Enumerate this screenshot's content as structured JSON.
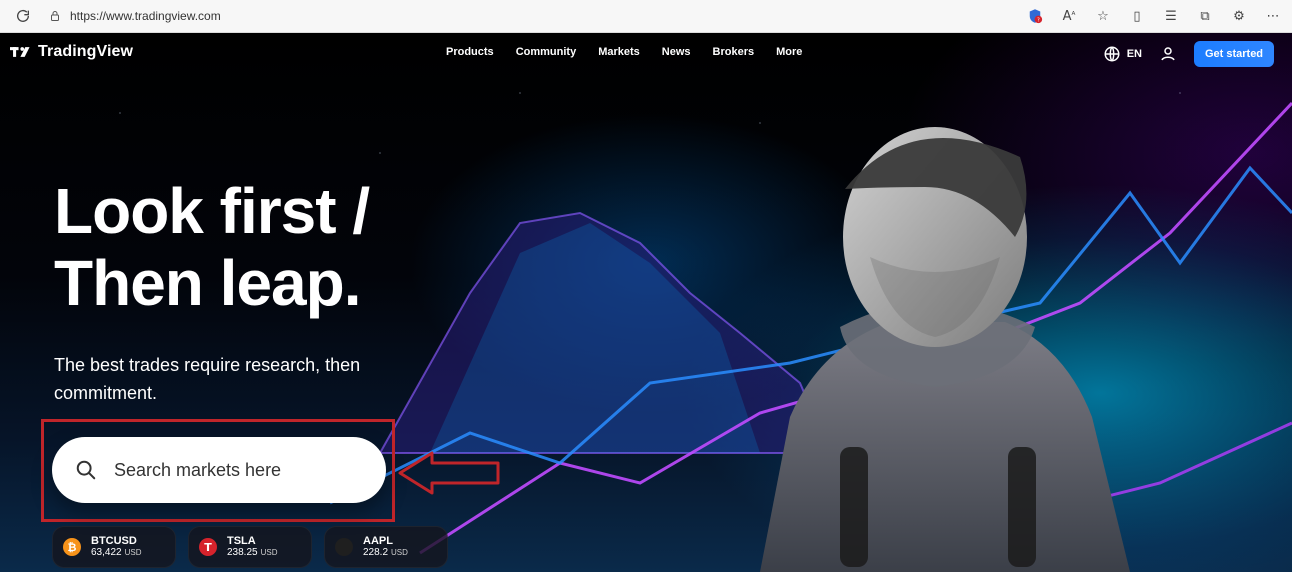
{
  "browser": {
    "url": "https://www.tradingview.com",
    "icons": [
      "reload-icon",
      "lock-icon",
      "shield-badge-icon",
      "read-aloud-icon",
      "favorite-icon",
      "split-screen-icon",
      "favorites-icon",
      "collections-icon",
      "extensions-icon",
      "more-icon"
    ]
  },
  "header": {
    "logo_text": "TradingView",
    "nav": [
      "Products",
      "Community",
      "Markets",
      "News",
      "Brokers",
      "More"
    ],
    "lang": "EN",
    "cta": "Get started"
  },
  "hero": {
    "title_line1": "Look first /",
    "title_line2": "Then leap.",
    "subtitle": "The best trades require research, then commitment."
  },
  "search": {
    "placeholder": "Search markets here"
  },
  "tickers": [
    {
      "symbol": "BTCUSD",
      "value": "63,422",
      "currency": "USD",
      "icon": "bitcoin-icon",
      "color": "#f7931a"
    },
    {
      "symbol": "TSLA",
      "value": "238.25",
      "currency": "USD",
      "icon": "tesla-icon",
      "color": "#d6232c"
    },
    {
      "symbol": "AAPL",
      "value": "228.2",
      "currency": "USD",
      "icon": "apple-icon",
      "color": "#1f1f1f"
    }
  ],
  "colors": {
    "cta": "#2f86ff",
    "annotation": "#c0252a",
    "hero_bg": "#000000"
  }
}
